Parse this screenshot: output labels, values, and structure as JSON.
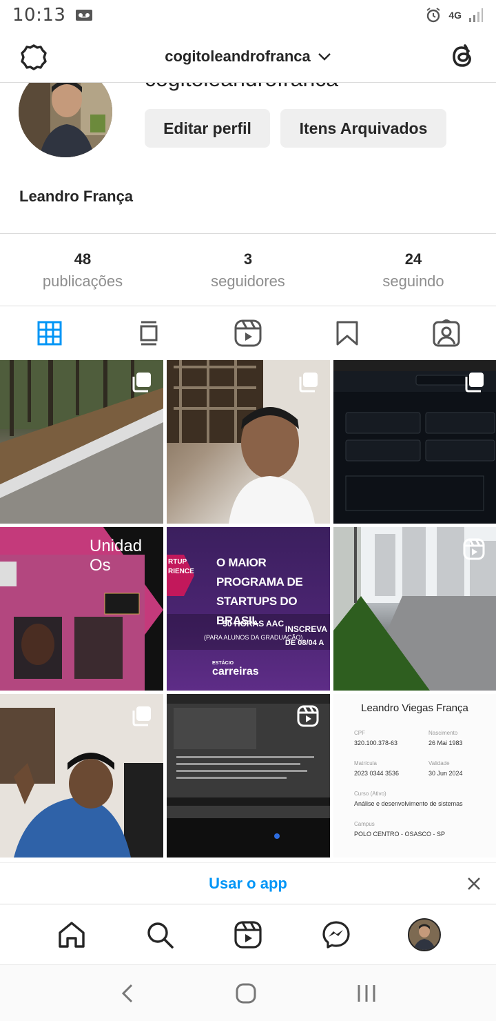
{
  "status_bar": {
    "time": "10:13",
    "network": "4G",
    "icons": [
      "voicemail-icon",
      "alarm-icon",
      "network-4g-icon",
      "signal-icon"
    ]
  },
  "header": {
    "username": "cogitoleandrofranca",
    "icons": [
      "settings-icon",
      "chevron-down-icon",
      "threads-icon"
    ]
  },
  "profile": {
    "partial_username": "cogitoleandrofranca",
    "edit_label": "Editar perfil",
    "archive_label": "Itens Arquivados",
    "full_name": "Leandro França"
  },
  "stats": [
    {
      "value": "48",
      "label": "publicações"
    },
    {
      "value": "3",
      "label": "seguidores"
    },
    {
      "value": "24",
      "label": "seguindo"
    }
  ],
  "tabs": [
    "grid-icon",
    "feed-icon",
    "reels-icon",
    "saved-icon",
    "tagged-icon"
  ],
  "grid": {
    "unidade_text": "Unidad Os",
    "promo": {
      "headline": "O MAIOR PROGRAMA DE STARTUPS DO BRASIL",
      "left_cut": "RTUP RIENCE",
      "hours": "50 HORAS AAC",
      "hours_sub": "(PARA ALUNOS DA GRADUAÇÃO)",
      "subscribe": "INSCREVA",
      "date": "DE 08/04 A",
      "logo_top": "ESTÁCIO",
      "logo": "carreiras"
    },
    "card": {
      "name": "Leandro Viegas França",
      "fields": [
        {
          "label": "CPF",
          "value": "320.100.378-63"
        },
        {
          "label": "Nascimento",
          "value": "26 Mai 1983"
        },
        {
          "label": "Matrícula",
          "value": "2023 0344 3536"
        },
        {
          "label": "Validade",
          "value": "30 Jun 2024"
        },
        {
          "label": "Curso (Ativo)",
          "value": "Análise e desenvolvimento de sistemas"
        },
        {
          "label": "Campus",
          "value": "POLO CENTRO - OSASCO - SP"
        }
      ]
    }
  },
  "banner": {
    "cta": "Usar o app"
  },
  "bottom_nav": [
    "home-icon",
    "search-icon",
    "reels-icon",
    "messenger-icon",
    "profile-avatar"
  ],
  "system_nav": [
    "back-icon",
    "home-circle-icon",
    "recents-icon"
  ],
  "colors": {
    "accent": "#0095f6",
    "grid_active": "#0095f6",
    "text": "#262626",
    "muted": "#8e8e8e"
  }
}
